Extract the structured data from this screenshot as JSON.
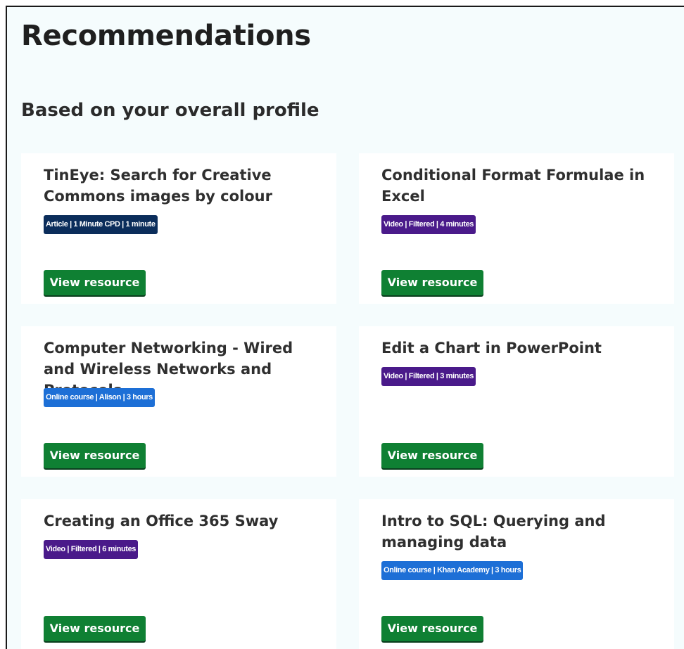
{
  "page": {
    "title": "Recommendations",
    "section_title": "Based on your overall profile"
  },
  "colors": {
    "badge_article": "#0b2d5b",
    "badge_video": "#4a1a8a",
    "badge_online_course": "#1d6fd6",
    "button": "#0f8033"
  },
  "cards": [
    {
      "title": "TinEye: Search for Creative Commons images by colour",
      "badge": "Article | 1 Minute CPD | 1 minute",
      "badge_type": "article",
      "button_label": "View resource"
    },
    {
      "title": "Conditional Format Formulae in Excel",
      "badge": "Video | Filtered | 4 minutes",
      "badge_type": "video",
      "button_label": "View resource"
    },
    {
      "title": "Computer Networking - Wired and Wireless Networks and Protocols",
      "badge": "Online course | Alison | 3 hours",
      "badge_type": "online_course",
      "button_label": "View resource"
    },
    {
      "title": "Edit a Chart in PowerPoint",
      "badge": "Video | Filtered | 3 minutes",
      "badge_type": "video",
      "button_label": "View resource"
    },
    {
      "title": "Creating an Office 365 Sway",
      "badge": "Video | Filtered | 6 minutes",
      "badge_type": "video",
      "button_label": "View resource"
    },
    {
      "title": "Intro to SQL: Querying and managing data",
      "badge": "Online course | Khan Academy | 3 hours",
      "badge_type": "online_course",
      "button_label": "View resource"
    }
  ]
}
